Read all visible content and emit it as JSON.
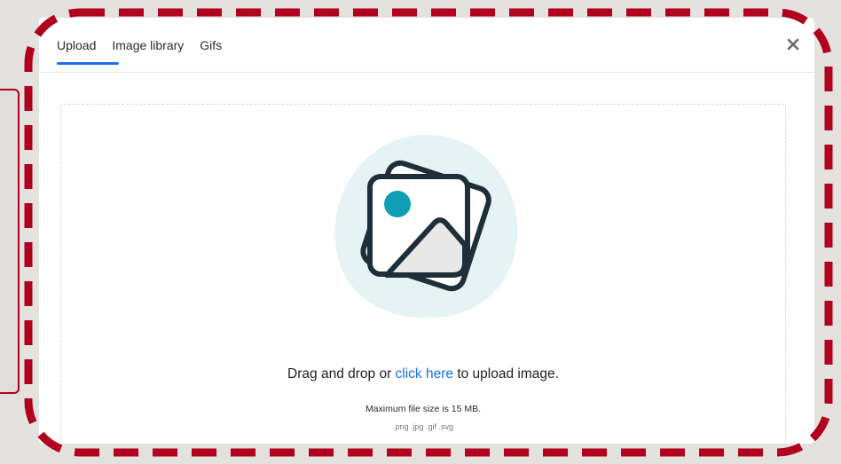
{
  "tabs": [
    {
      "label": "Upload",
      "active": true
    },
    {
      "label": "Image library",
      "active": false
    },
    {
      "label": "Gifs",
      "active": false
    }
  ],
  "close_icon": "close-icon",
  "dropzone": {
    "illustration_icon": "image-upload-icon",
    "text_before": "Drag and drop or ",
    "link_text": "click here",
    "text_after": " to upload image.",
    "max_size": "Maximum file size is 15 MB.",
    "formats": ".png .jpg .gif .svg"
  },
  "colors": {
    "accent": "#1a73e8",
    "frame": "#b0001e",
    "blob": "#e6f3f5",
    "dot": "#0e9db5",
    "stroke": "#1f2f3a"
  }
}
